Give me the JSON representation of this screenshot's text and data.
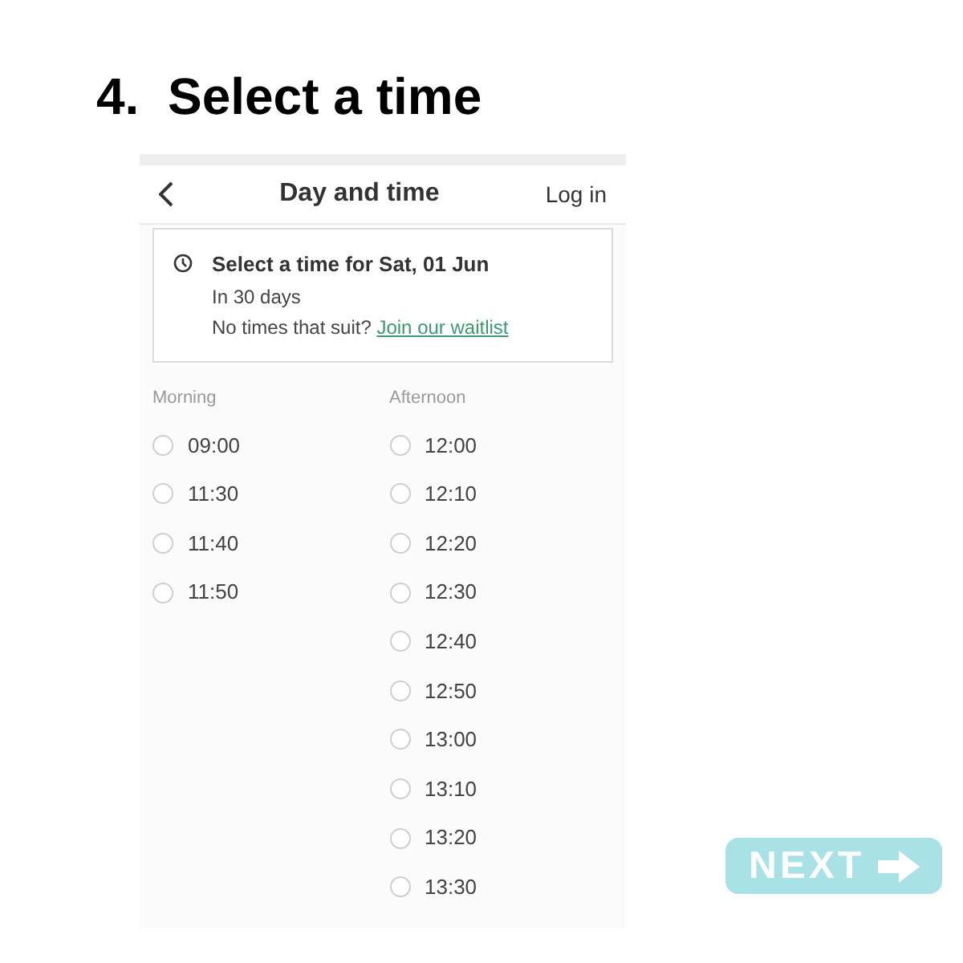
{
  "heading": "4.  Select a time",
  "header": {
    "title": "Day and time",
    "login": "Log in"
  },
  "info": {
    "title": "Select a time for Sat, 01 Jun",
    "subtitle": "In 30 days",
    "prompt": "No times that suit? ",
    "link": "Join our waitlist"
  },
  "columns": [
    {
      "label": "Morning",
      "slots": [
        {
          "time": "09:00",
          "selected": false
        },
        {
          "time": "11:30",
          "selected": false
        },
        {
          "time": "11:40",
          "selected": false
        },
        {
          "time": "11:50",
          "selected": false
        }
      ]
    },
    {
      "label": "Afternoon",
      "slots": [
        {
          "time": "12:00",
          "selected": false
        },
        {
          "time": "12:10",
          "selected": false
        },
        {
          "time": "12:20",
          "selected": false
        },
        {
          "time": "12:30",
          "selected": false
        },
        {
          "time": "12:40",
          "selected": false
        },
        {
          "time": "12:50",
          "selected": false
        },
        {
          "time": "13:00",
          "selected": false
        },
        {
          "time": "13:10",
          "selected": false
        },
        {
          "time": "13:20",
          "selected": false
        },
        {
          "time": "13:30",
          "selected": false
        }
      ]
    }
  ],
  "next_button": "NEXT"
}
